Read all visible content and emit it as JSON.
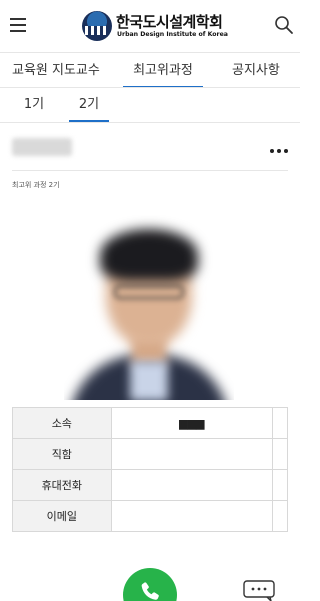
{
  "header": {
    "logo_ko": "한국도시설계학회",
    "logo_en": "Urban Design Institute of Korea",
    "menu_icon": "hamburger-icon",
    "search_icon": "search-icon"
  },
  "main_tabs": [
    {
      "label": "교육원 지도교수"
    },
    {
      "label": "최고위과정"
    },
    {
      "label": "공지사항"
    }
  ],
  "sub_tabs": [
    {
      "label": "1기"
    },
    {
      "label": "2기"
    }
  ],
  "active_main_tab": 1,
  "active_sub_tab": 1,
  "post": {
    "title": "",
    "category": "최고위 과정 2기"
  },
  "info_rows": [
    {
      "label": "소속",
      "value": ""
    },
    {
      "label": "직함",
      "value": ""
    },
    {
      "label": "휴대전화",
      "value": ""
    },
    {
      "label": "이메일",
      "value": ""
    }
  ],
  "colors": {
    "accent": "#1e6fc8",
    "call": "#27b34a",
    "border": "#e6e6e6"
  }
}
